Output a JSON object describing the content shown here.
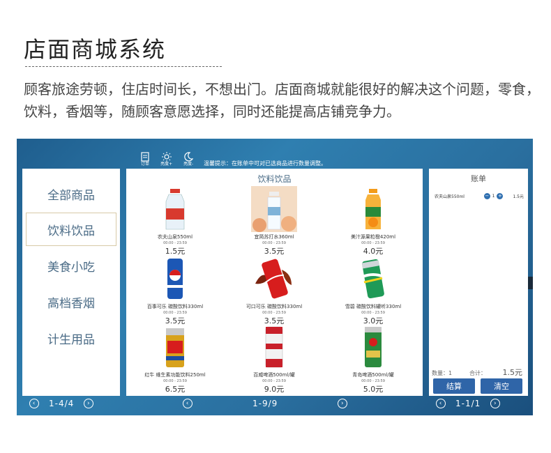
{
  "header": {
    "title": "店面商城系统",
    "description": "顾客旅途劳顿，住店时间长，不想出门。店面商城就能很好的解决这个问题，零食，饮料，香烟等，随顾客意愿选择，同时还能提高店铺竞争力。"
  },
  "toolbar": {
    "order_label": "订单",
    "bright_label": "亮度+",
    "dim_label": "亮度-",
    "tip": "温馨提示：在账单中可对已选商品进行数量调整。"
  },
  "categories": [
    {
      "label": "全部商品"
    },
    {
      "label": "饮料饮品",
      "active": true
    },
    {
      "label": "美食小吃"
    },
    {
      "label": "高档香烟"
    },
    {
      "label": "计生用品"
    }
  ],
  "products": {
    "section_title": "饮料饮品",
    "items": [
      {
        "name": "农夫山泉550ml",
        "time": "00:00 - 23:59",
        "price": "1.5元",
        "color": "#d83a2e"
      },
      {
        "name": "宜简苏打水360ml",
        "time": "00:00 - 23:59",
        "price": "3.5元",
        "color": "#e9b070"
      },
      {
        "name": "美汁源果粒橙420ml",
        "time": "00:00 - 23:59",
        "price": "4.0元",
        "color": "#f39b1a"
      },
      {
        "name": "百事可乐 碳酸饮料330ml",
        "time": "00:00 - 23:59",
        "price": "3.5元",
        "color": "#1c57b5"
      },
      {
        "name": "可口可乐 碳酸饮料330ml",
        "time": "00:00 - 23:59",
        "price": "3.5元",
        "color": "#d71d1d"
      },
      {
        "name": "雪碧 碳酸饮料罐听330ml",
        "time": "00:00 - 23:59",
        "price": "3.0元",
        "color": "#1f9a57"
      },
      {
        "name": "红牛 维生素功能饮料250ml",
        "time": "00:00 - 23:59",
        "price": "6.5元",
        "color": "#d8a21c"
      },
      {
        "name": "百威啤酒500ml/罐",
        "time": "00:00 - 23:59",
        "price": "9.0元",
        "color": "#c8202a"
      },
      {
        "name": "青岛啤酒500ml/罐",
        "time": "00:00 - 23:59",
        "price": "5.0元",
        "color": "#2b8a3e"
      }
    ]
  },
  "bill": {
    "title": "账单",
    "line": {
      "name": "农夫山泉550ml",
      "qty": "1",
      "price": "1.5元"
    },
    "count_label": "数量：1",
    "total_label": "合计：",
    "total": "1.5元",
    "checkout_label": "结算",
    "clear_label": "清空"
  },
  "pagers": {
    "left": "1-4/4",
    "middle": "1-9/9",
    "right": "1-1/1"
  }
}
